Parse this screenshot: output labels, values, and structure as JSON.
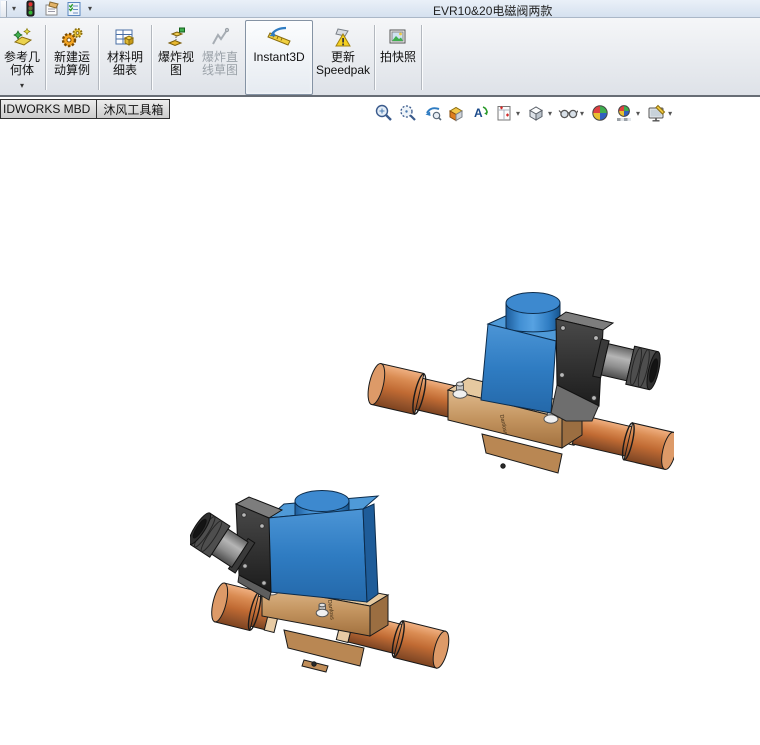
{
  "window": {
    "title": "EVR10&20电磁阀两款"
  },
  "quick_access": {
    "dropdown_left": "▾",
    "dropdown_right": "▾",
    "icons": [
      "rebuild-traffic-light-icon",
      "edit-note-icon",
      "design-checker-icon"
    ]
  },
  "command_manager": {
    "buttons": [
      {
        "id": "reference-geometry",
        "line1": "参考几",
        "line2": "何体",
        "dropdown": "▾",
        "enabled": true,
        "pressed": false
      },
      {
        "id": "new-motion-study",
        "line1": "新建运",
        "line2": "动算例",
        "enabled": true,
        "pressed": false
      },
      {
        "id": "bill-of-materials",
        "line1": "材料明",
        "line2": "细表",
        "enabled": true,
        "pressed": false
      },
      {
        "id": "exploded-view",
        "line1": "爆炸视",
        "line2": "图",
        "enabled": true,
        "pressed": false
      },
      {
        "id": "explode-line-sketch",
        "line1": "爆炸直",
        "line2": "线草图",
        "enabled": false,
        "pressed": false
      },
      {
        "id": "instant3d",
        "line1": "Instant3D",
        "line2": "",
        "enabled": true,
        "pressed": true
      },
      {
        "id": "update-speedpak",
        "line1": "更新",
        "line2": "Speedpak",
        "enabled": true,
        "pressed": false
      },
      {
        "id": "take-snapshot",
        "line1": "拍快照",
        "line2": "",
        "enabled": true,
        "pressed": false
      }
    ]
  },
  "tabs": [
    {
      "label": "IDWORKS MBD",
      "note": "left edge clipped by window"
    },
    {
      "label": "沐风工具箱"
    }
  ],
  "view_toolbar": {
    "icons": [
      {
        "name": "zoom-to-fit"
      },
      {
        "name": "zoom-to-area"
      },
      {
        "name": "previous-view"
      },
      {
        "name": "section-view"
      },
      {
        "name": "dynamic-annotation-views"
      },
      {
        "name": "view-orientation",
        "dropdown": "▾"
      },
      {
        "name": "display-style",
        "dropdown": "▾"
      },
      {
        "name": "hide-show-items",
        "dropdown": "▾"
      },
      {
        "name": "edit-appearance"
      },
      {
        "name": "apply-scene",
        "dropdown": "▾"
      },
      {
        "name": "view-settings",
        "dropdown": "▾"
      }
    ]
  },
  "viewport": {
    "background": "#ffffff",
    "models": [
      {
        "id": "valve-upper",
        "description": "EVR solenoid valve, blue coil, cable connector facing right, copper tubes",
        "brand_mark": "Danfoss",
        "position": "upper-right"
      },
      {
        "id": "valve-lower",
        "description": "EVR solenoid valve, blue coil, cable connector facing left, copper tubes",
        "brand_mark": "Danfoss",
        "position": "lower-left"
      }
    ],
    "colors": {
      "coil_blue": "#2f7cc2",
      "coil_blue_top": "#4f9ad8",
      "connector_dark": "#2d2d2d",
      "gland_gray": "#8e8e8e",
      "body_brass": "#c3945f",
      "pipe_copper": "#c06a33",
      "titlebar": "#d5e1ef"
    }
  }
}
